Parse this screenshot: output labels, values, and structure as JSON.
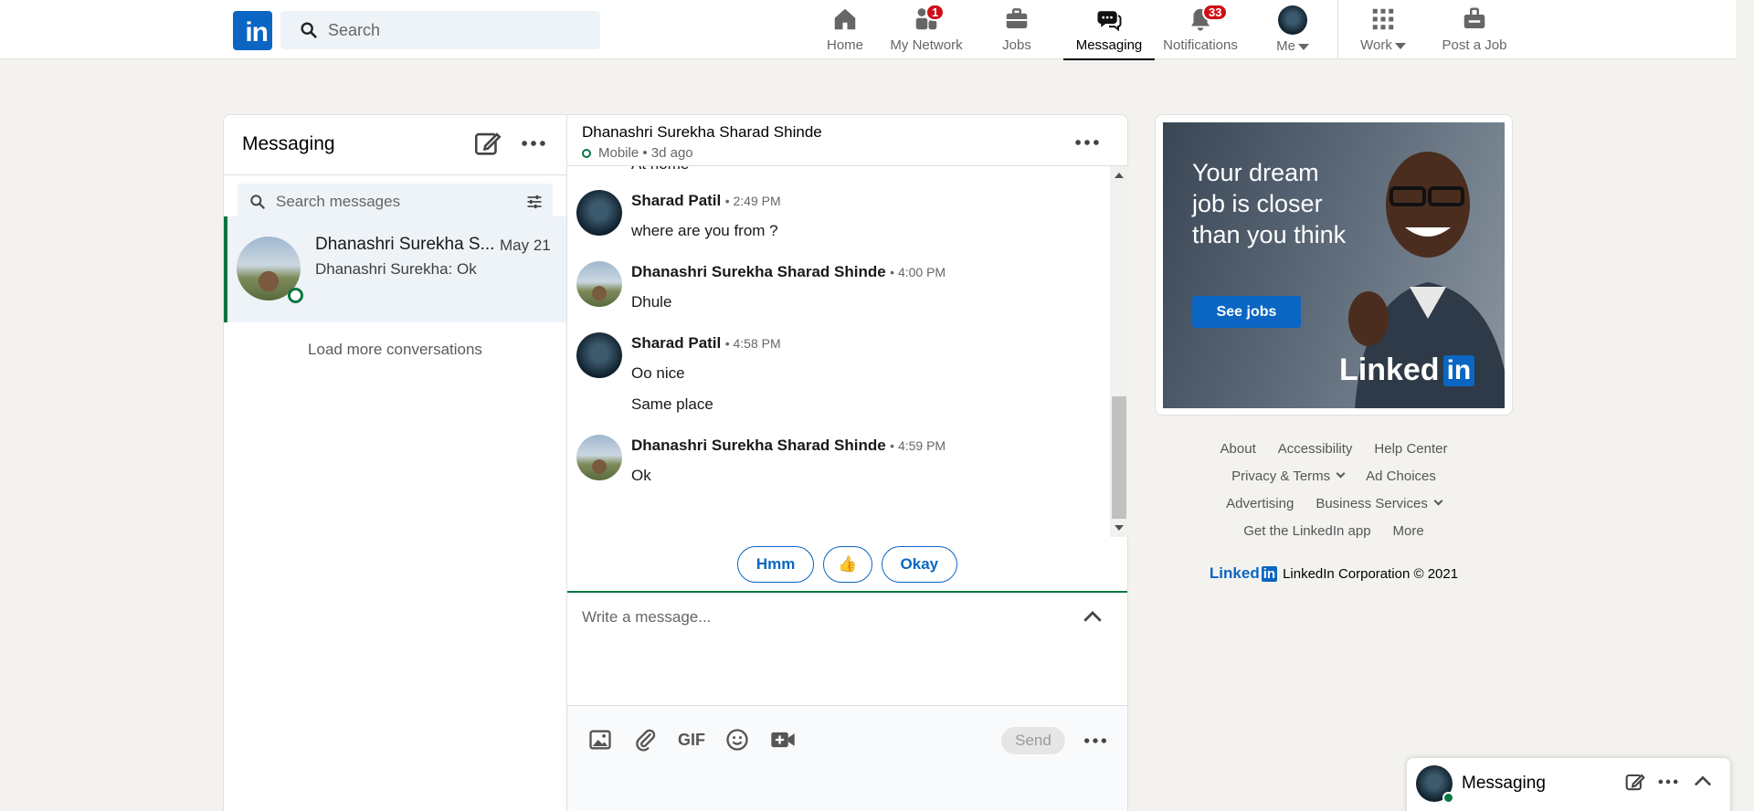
{
  "nav": {
    "search_placeholder": "Search",
    "items": [
      {
        "label": "Home",
        "icon": "home-icon"
      },
      {
        "label": "My Network",
        "icon": "network-icon",
        "badge": "1"
      },
      {
        "label": "Jobs",
        "icon": "briefcase-icon"
      },
      {
        "label": "Messaging",
        "icon": "messaging-icon",
        "active": true
      },
      {
        "label": "Notifications",
        "icon": "bell-icon",
        "badge": "33"
      },
      {
        "label": "Me",
        "icon": "avatar"
      },
      {
        "label": "Work",
        "icon": "grid-icon"
      },
      {
        "label": "Post a Job",
        "icon": "post-job-icon"
      }
    ]
  },
  "left": {
    "title": "Messaging",
    "search_placeholder": "Search messages",
    "conversation": {
      "name": "Dhanashri Surekha S...",
      "date": "May 21",
      "preview": "Dhanashri Surekha: Ok"
    },
    "load_more": "Load more conversations"
  },
  "thread": {
    "name": "Dhanashri Surekha Sharad Shinde",
    "status": "Mobile • 3d ago",
    "cut_text": "At home",
    "groups": [
      {
        "sender": "Sharad Patil",
        "time": "• 2:49 PM",
        "messages": [
          "where are you from ?"
        ]
      },
      {
        "sender": "Dhanashri Surekha Sharad Shinde",
        "time": "• 4:00 PM",
        "messages": [
          "Dhule"
        ]
      },
      {
        "sender": "Sharad Patil",
        "time": "• 4:58 PM",
        "messages": [
          "Oo nice",
          "Same place"
        ]
      },
      {
        "sender": "Dhanashri Surekha Sharad Shinde",
        "time": "• 4:59 PM",
        "messages": [
          "Ok"
        ]
      }
    ],
    "quick_replies": [
      "Hmm",
      "👍",
      "Okay"
    ],
    "compose_placeholder": "Write a message...",
    "send_label": "Send",
    "gif_label": "GIF"
  },
  "ad": {
    "headline": "Your dream job is closer than you think",
    "button": "See jobs",
    "logo_text": "Linked",
    "logo_in": "in"
  },
  "footer": {
    "row1": [
      "About",
      "Accessibility",
      "Help Center"
    ],
    "row2": [
      "Privacy & Terms",
      "Ad Choices"
    ],
    "row3": [
      "Advertising",
      "Business Services"
    ],
    "row4": [
      "Get the LinkedIn app",
      "More"
    ],
    "logo_text": "Linked",
    "logo_in": "in",
    "copyright": "LinkedIn Corporation © 2021"
  },
  "dock": {
    "title": "Messaging"
  },
  "colors": {
    "brand": "#0a66c2",
    "online": "#057642",
    "badge": "#cc1016"
  }
}
